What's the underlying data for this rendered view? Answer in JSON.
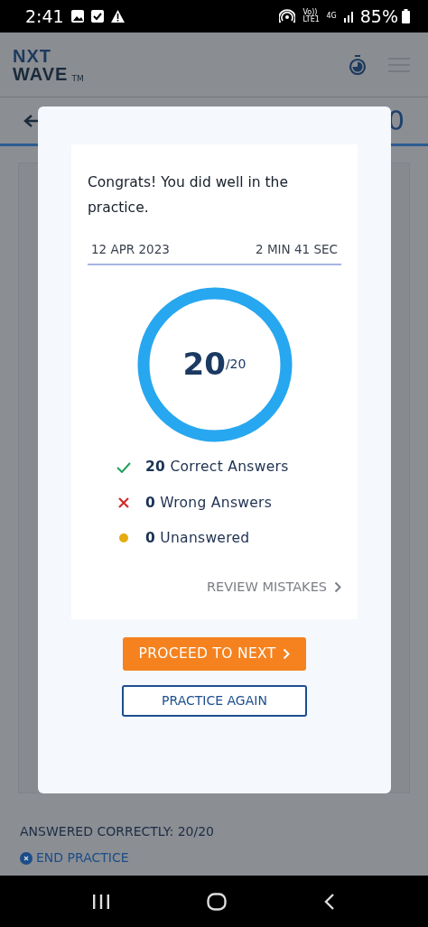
{
  "status_bar": {
    "time": "2:41",
    "network": "Vo)) LTE1",
    "data": "4G",
    "battery": "85%"
  },
  "header": {
    "logo_top": "NXT",
    "logo_bottom": "WAVE",
    "trademark": "TM"
  },
  "subheader": {
    "right_text": "0"
  },
  "modal": {
    "message": "Congrats! You did well in the practice.",
    "date": "12 APR 2023",
    "duration": "2 MIN 41 SEC",
    "score": {
      "value": "20",
      "total": "/20",
      "level": 1
    },
    "results": [
      {
        "kind": "correct",
        "count": "20",
        "label": "Correct Answers"
      },
      {
        "kind": "wrong",
        "count": "0",
        "label": "Wrong Answers"
      },
      {
        "kind": "unanswered",
        "count": "0",
        "label": "Unanswered"
      }
    ],
    "review_link": "REVIEW MISTAKES",
    "primary_button": "PROCEED TO NEXT",
    "secondary_button": "PRACTICE AGAIN"
  },
  "footer": {
    "summary": "ANSWERED CORRECTLY: 20/20",
    "end_link": "END PRACTICE"
  }
}
